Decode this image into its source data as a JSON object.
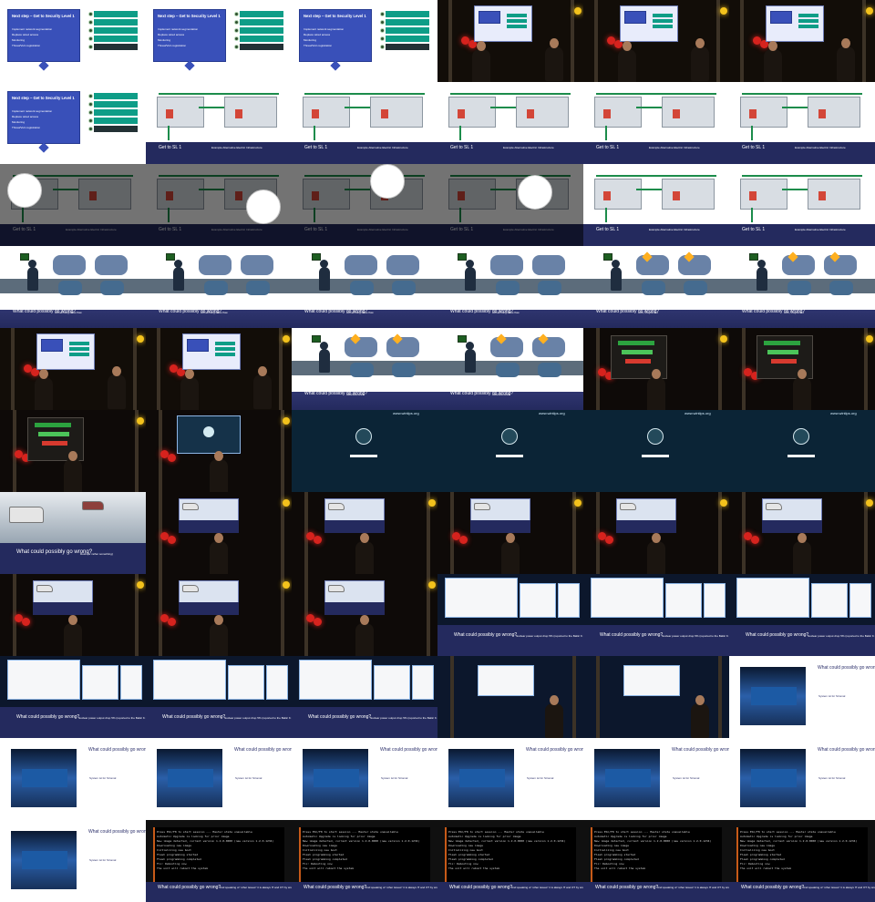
{
  "slides": [
    {
      "title": "Next step – Get to Security Level 1",
      "items": [
        "Implement network segmentation",
        "Replace wired access",
        "Monitoring",
        "Threat/Vuln registration"
      ]
    },
    {
      "title": "Get to SL 1",
      "subtitle": "Example Alternative Electric Infrastructure"
    },
    {
      "title": "What could possibly go wrong?",
      "subtitle": "Overriding locks flow"
    },
    {
      "title": "What could possibly go wrong?",
      "subtitle": "Oh, maybe not"
    },
    {
      "title": "What could possibly go wrong?",
      "subtitle": "Ransomware"
    },
    {
      "title": "What could possibly go wrong?",
      "subtitle": "Rush (or rather something)"
    },
    {
      "title": "What could possibly go wrong?",
      "subtitle": "Nuclear power output drop 5% (reported to the Baltic K nuclear power plant)"
    },
    {
      "title": "What could possibly go wrong?",
      "subtitle": "System ist for Stromal"
    },
    {
      "title": "What could possibly go wrong?",
      "subtitle": "And speaking of “other issues” it is always IT and OT by wrong other corporate upgrades"
    }
  ],
  "watermark": "www.wintips.org",
  "terminal": {
    "line1": "Press ESC/F8 to start session --- Master state unavailable",
    "line2": "Automatic Upgrade is looking for prior image",
    "line3": "New image detected, current version 1.2.0-0000 (new version 1.2.0.1234)",
    "line4": "Downloading new image",
    "line5": "Initializing new boot",
    "line6": "Flash programming started",
    "line7": "Flash programming completed",
    "line8": "Fix: Rebooting now",
    "line9": "The unit will reboot the system"
  }
}
